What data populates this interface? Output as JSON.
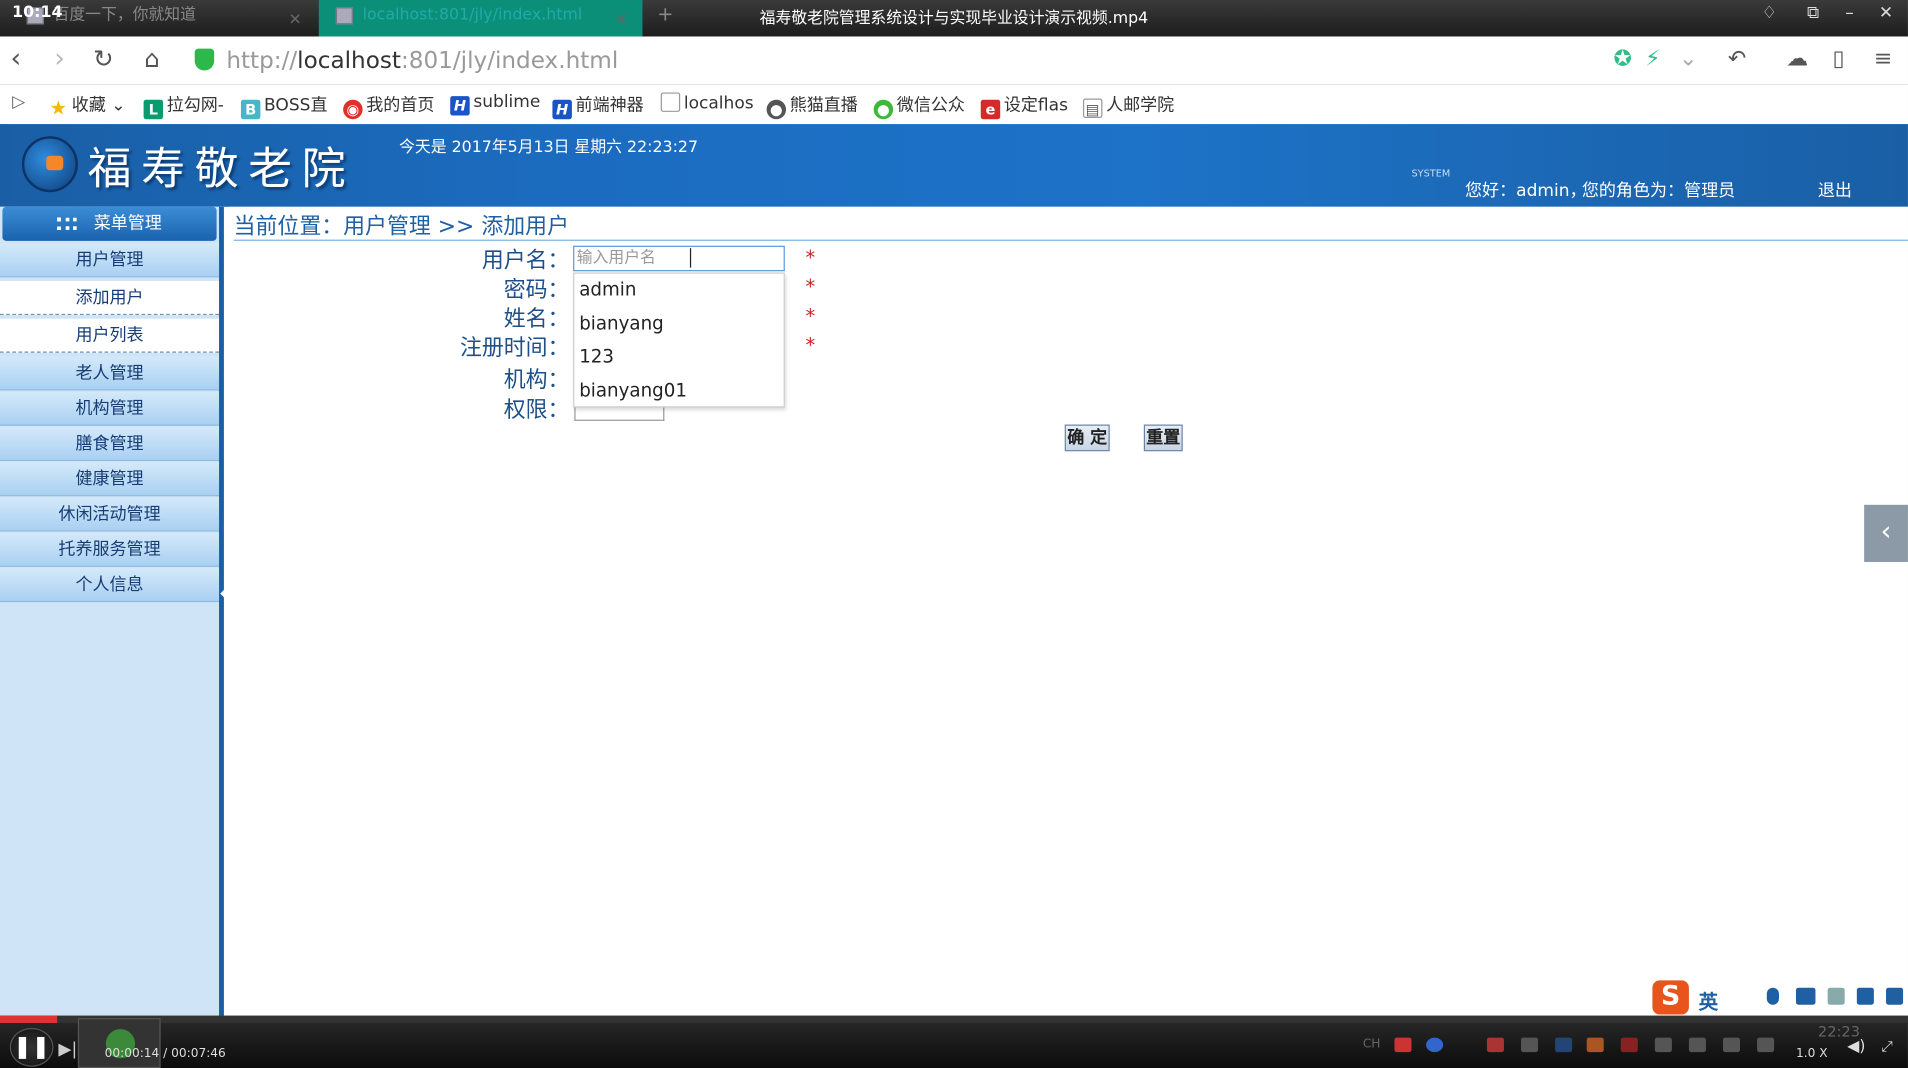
{
  "browser": {
    "clock": "10:14",
    "tabs": [
      {
        "label": "百度一下，你就知道",
        "close": "✕"
      },
      {
        "label": "localhost:801/jly/index.html",
        "close": "✕"
      }
    ],
    "new_tab": "+",
    "video_title": "福寿敬老院管理系统设计与实现毕业设计演示视频.mp4",
    "url_prefix": "http://",
    "url_host": "localhost",
    "url_rest": ":801/jly/index.html",
    "bookmarks": [
      "收藏",
      "拉勾网-",
      "BOSS直",
      "我的首页",
      "sublime",
      "前端神器",
      "localhos",
      "熊猫直播",
      "微信公众",
      "设定flas",
      "人邮学院"
    ]
  },
  "app": {
    "logo_text": "福寿敬老院",
    "date_text": "今天是 2017年5月13日 星期六 22:23:27",
    "system_label": "SYSTEM",
    "greeting": "您好：admin，",
    "role_text": "您的角色为：管理员",
    "logout": "退出"
  },
  "sidebar": {
    "header": "菜单管理",
    "items": [
      {
        "label": "用户管理"
      },
      {
        "label": "添加用户"
      },
      {
        "label": "用户列表"
      },
      {
        "label": "老人管理"
      },
      {
        "label": "机构管理"
      },
      {
        "label": "膳食管理"
      },
      {
        "label": "健康管理"
      },
      {
        "label": "休闲活动管理"
      },
      {
        "label": "托养服务管理"
      },
      {
        "label": "个人信息"
      }
    ]
  },
  "page": {
    "breadcrumb": "当前位置：用户管理 >> 添加用户",
    "form": {
      "username_label": "用户名：",
      "username_placeholder": "输入用户名",
      "password_label": "密码：",
      "name_label": "姓名：",
      "regtime_label": "注册时间：",
      "org_label": "机构：",
      "perm_label": "权限：",
      "required_mark": "*",
      "autocomplete": [
        "admin",
        "bianyang",
        "123",
        "bianyang01"
      ],
      "confirm": "确 定",
      "reset": "重置"
    },
    "right_tab": "‹"
  },
  "ime": {
    "label": "英",
    "logo": "S"
  },
  "player": {
    "time": "00:00:14 / 00:07:46",
    "speed": "1.0 X",
    "tray_clock": "22:23",
    "progress": 0.03
  }
}
